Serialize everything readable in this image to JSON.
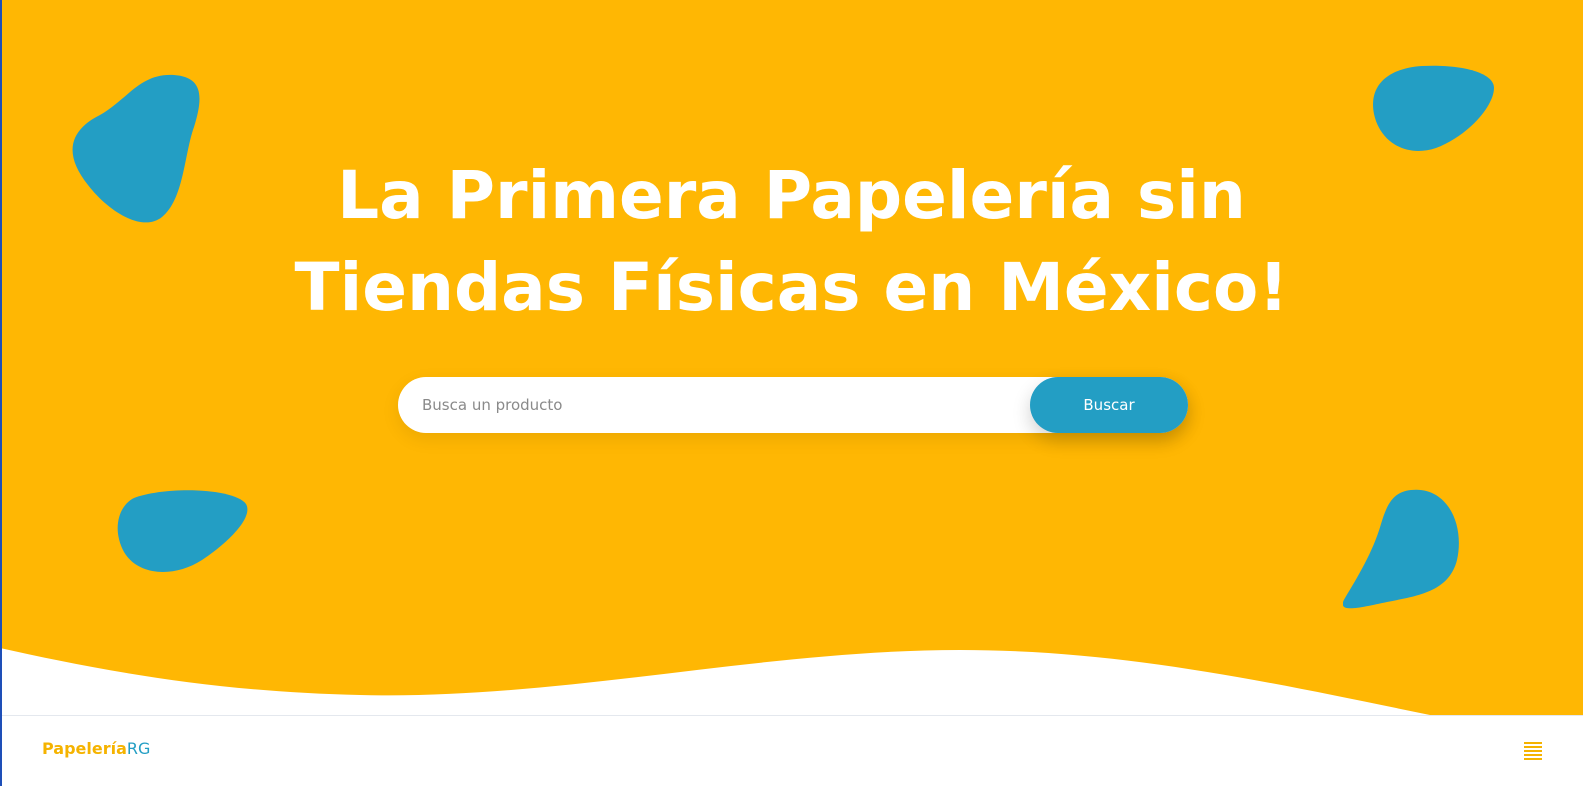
{
  "hero": {
    "headline_line1": "La Primera Papelería sin",
    "headline_line2": "Tiendas Físicas en México!",
    "background_color": "#ffb703",
    "blob_color": "#239ec4"
  },
  "search": {
    "placeholder": "Busca un producto",
    "value": "",
    "button_label": "Buscar"
  },
  "navbar": {
    "brand_main": "Papelería",
    "brand_accent": "RG",
    "menu_icon": "hamburger-menu-icon"
  },
  "colors": {
    "accent_yellow": "#f5b300",
    "accent_blue": "#239ec4",
    "white": "#ffffff"
  }
}
